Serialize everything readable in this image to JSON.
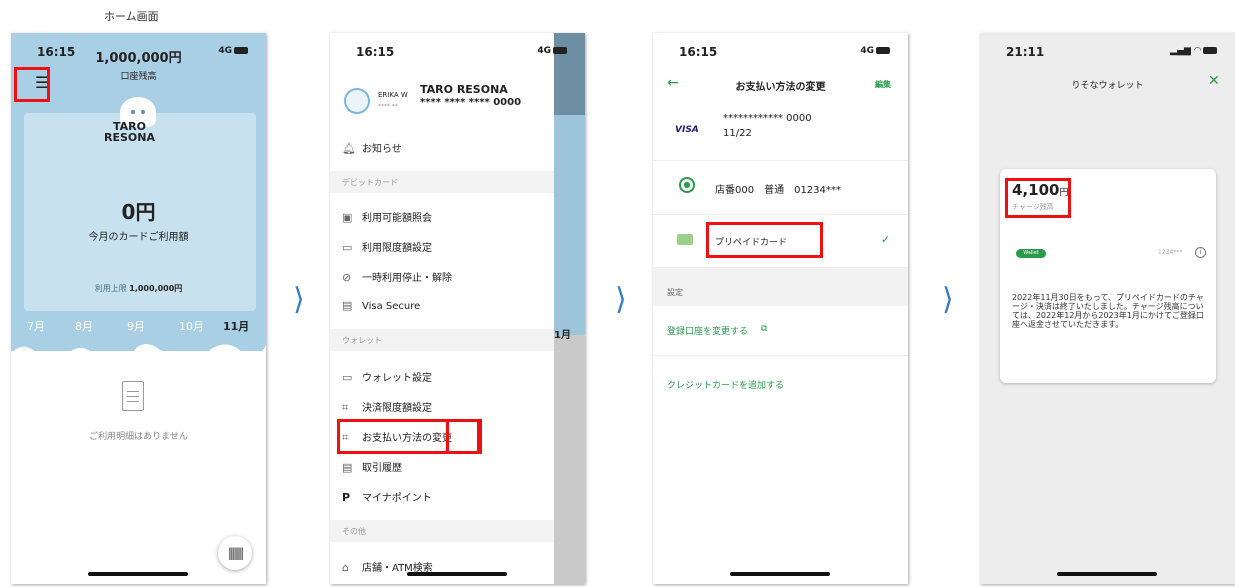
{
  "caption": "ホーム画面",
  "phone1": {
    "time": "16:15",
    "signal": "4G",
    "balance": "1,000,000円",
    "balance_label": "口座残高",
    "cardholder": [
      "TARO",
      "RESONA"
    ],
    "usage_amount": "0円",
    "usage_label": "今月のカードご利用額",
    "limit_label": "利用上限",
    "limit_value": "1,000,000円",
    "months": [
      "7月",
      "8月",
      "9月",
      "10月",
      "11月"
    ],
    "selected_month": "11月",
    "empty_text": "ご利用明細はありません"
  },
  "phone2": {
    "time": "16:15",
    "signal": "4G",
    "user_short": "ERIKA W",
    "user_short_stars": "**** **",
    "user_name": "TARO RESONA",
    "card_number": "**** **** **** 0000",
    "notification": "お知らせ",
    "section_debit": "デビットカード",
    "debit_items": [
      "利用可能額照会",
      "利用限度額設定",
      "一時利用停止・解除",
      "Visa Secure"
    ],
    "section_wallet": "ウォレット",
    "wallet_items": [
      "ウォレット設定",
      "決済限度額設定",
      "お支払い方法の変更",
      "取引履歴",
      "マイナポイント"
    ],
    "section_other": "その他",
    "other_items": [
      "店舗・ATM検索"
    ],
    "peek_month": "1月"
  },
  "phone3": {
    "time": "16:15",
    "signal": "4G",
    "title": "お支払い方法の変更",
    "edit": "編集",
    "visa_brand": "VISA",
    "visa_number": "************ 0000",
    "visa_expiry": "11/22",
    "bank_account": "店番000　普通　01234***",
    "prepaid": "プリペイドカード",
    "section_settings": "設定",
    "change_account": "登録口座を変更する",
    "add_credit": "クレジットカードを追加する"
  },
  "phone4": {
    "time": "21:11",
    "title": "りそなウォレット",
    "balance": "4,100",
    "balance_unit": "円",
    "balance_label": "チャージ残高",
    "wallet_pill": "Wallet",
    "card_tail": "1234***",
    "notice": "2022年11月30日をもって、プリペイドカードのチャージ・決済は終了いたしました。チャージ残高については、2022年12月から2023年1月にかけてご登録口座へ返金させていただきます。"
  },
  "colors": {
    "home_blue": "#a9cfe4",
    "accent_green": "#2b9a4a",
    "highlight_red": "#e11111",
    "arrow_blue": "#3a7ec4"
  }
}
